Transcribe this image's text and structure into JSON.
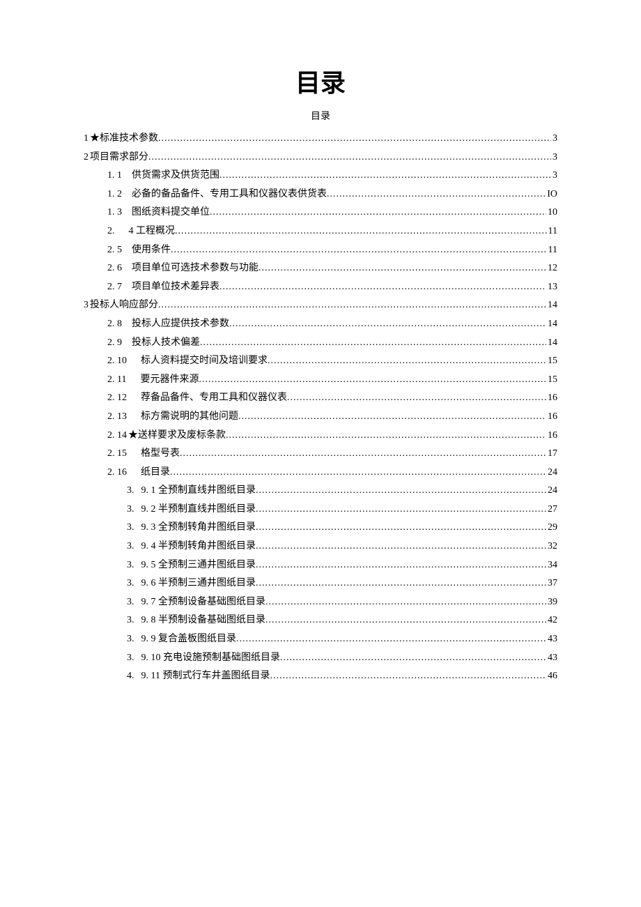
{
  "title": "目录",
  "subtitle": "目录",
  "entries": [
    {
      "level": 0,
      "num": "1",
      "text": " ★标准技术参数",
      "page": "3",
      "gap": ""
    },
    {
      "level": 0,
      "num": "2",
      "text": "项目需求部分",
      "page": "3",
      "gap": ""
    },
    {
      "level": 1,
      "num": "1. 1",
      "text": "供货需求及供货范围",
      "page": "3",
      "gap": "gap-wide"
    },
    {
      "level": 1,
      "num": "1. 2",
      "text": "必备的备品备件、专用工具和仪器仪表供货表",
      "page": "IO",
      "gap": "gap-wide"
    },
    {
      "level": 1,
      "num": "1. 3",
      "text": "图纸资料提交单位",
      "page": "10",
      "gap": "gap-wide"
    },
    {
      "level": 1,
      "num": "2.",
      "text": "4 工程概况",
      "page": "11",
      "gap": "gap-xwide"
    },
    {
      "level": 1,
      "num": "2. 5",
      "text": "使用条件",
      "page": "11",
      "gap": "gap-wide"
    },
    {
      "level": 1,
      "num": "2. 6",
      "text": "项目单位可选技术参数与功能",
      "page": "12",
      "gap": "gap-wide"
    },
    {
      "level": 1,
      "num": "2. 7",
      "text": "项目单位技术差异表",
      "page": "13",
      "gap": "gap-wide"
    },
    {
      "level": 0,
      "num": "3",
      "text": "投标人响应部分",
      "page": "14",
      "gap": ""
    },
    {
      "level": 1,
      "num": "2. 8",
      "text": "投标人应提供技术参数",
      "page": "14",
      "gap": "gap-wide"
    },
    {
      "level": 1,
      "num": "2. 9",
      "text": "投标人技术偏差",
      "page": "14",
      "gap": "gap-wide"
    },
    {
      "level": 1,
      "num": "2. 10",
      "text": "标人资料提交时间及培训要求",
      "page": "15",
      "gap": "gap-xwide"
    },
    {
      "level": 1,
      "num": "2. 11",
      "text": "要元器件来源",
      "page": "15",
      "gap": "gap-xwide"
    },
    {
      "level": 1,
      "num": "2. 12",
      "text": "荐备品备件、专用工具和仪器仪表",
      "page": "16",
      "gap": "gap-xwide"
    },
    {
      "level": 1,
      "num": "2. 13",
      "text": "标方需说明的其他问题",
      "page": "16",
      "gap": "gap-xwide"
    },
    {
      "level": 1,
      "num": "2. 14",
      "text": "★送样要求及废标条款",
      "page": "16",
      "gap": ""
    },
    {
      "level": 1,
      "num": "2. 15",
      "text": "格型号表",
      "page": "17",
      "gap": "gap-xwide"
    },
    {
      "level": 1,
      "num": "2. 16",
      "text": "纸目录",
      "page": "24",
      "gap": "gap-xwide"
    },
    {
      "level": 2,
      "num": "3.",
      "text": "9. 1 全预制直线井图纸目录",
      "page": "24",
      "gap": "gap-2"
    },
    {
      "level": 2,
      "num": "3.",
      "text": "9. 2 半预制直线井图纸目录",
      "page": "27",
      "gap": "gap-2"
    },
    {
      "level": 2,
      "num": "3.",
      "text": "9. 3 全预制转角井图纸目录",
      "page": "29",
      "gap": "gap-2"
    },
    {
      "level": 2,
      "num": "3.",
      "text": "9. 4 半预制转角井图纸目录",
      "page": "32",
      "gap": "gap-2"
    },
    {
      "level": 2,
      "num": "3.",
      "text": "9. 5 全预制三通井图纸目录",
      "page": "34",
      "gap": "gap-2"
    },
    {
      "level": 2,
      "num": "3.",
      "text": "9. 6 半预制三通井图纸目录",
      "page": "37",
      "gap": "gap-2"
    },
    {
      "level": 2,
      "num": "3.",
      "text": "9. 7 全预制设备基础图纸目录",
      "page": "39",
      "gap": "gap-2"
    },
    {
      "level": 2,
      "num": "3.",
      "text": "9. 8 半预制设备基础图纸目录",
      "page": "42",
      "gap": "gap-2"
    },
    {
      "level": 2,
      "num": "3.",
      "text": "9. 9 复合盖板图纸目录",
      "page": "43",
      "gap": "gap-2"
    },
    {
      "level": 2,
      "num": "3.",
      "text": "9. 10 充电设施预制基础图纸目录",
      "page": "43",
      "gap": "gap-2"
    },
    {
      "level": 2,
      "num": "4.",
      "text": "9. 11 预制式行车井盖图纸目录",
      "page": "46",
      "gap": "gap-2"
    }
  ]
}
